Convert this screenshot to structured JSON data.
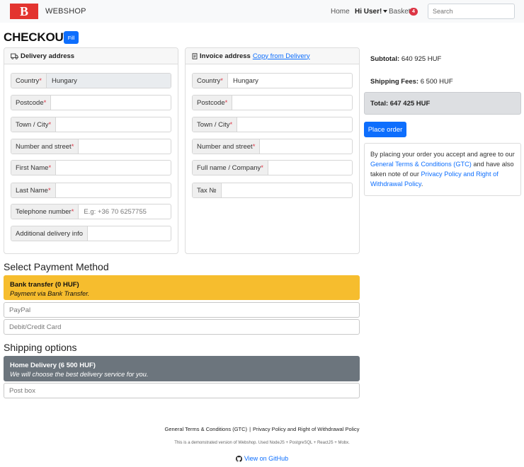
{
  "nav": {
    "logo_letter": "B",
    "brand": "WEBSHOP",
    "home": "Home",
    "user": "Hi User!",
    "basket": "Basket",
    "basket_count": "4",
    "search_placeholder": "Search"
  },
  "page": {
    "title": "CHECKOUT",
    "fill_button": "Fill"
  },
  "delivery": {
    "header": "Delivery address",
    "fields": {
      "country": {
        "label": "Country",
        "value": "Hungary"
      },
      "postcode": {
        "label": "Postcode",
        "value": ""
      },
      "town": {
        "label": "Town / City",
        "value": ""
      },
      "street": {
        "label": "Number and street",
        "value": ""
      },
      "first_name": {
        "label": "First Name",
        "value": ""
      },
      "last_name": {
        "label": "Last Name",
        "value": ""
      },
      "phone": {
        "label": "Telephone number",
        "placeholder": "E.g: +36 70 6257755"
      },
      "additional": {
        "label": "Additional delivery info",
        "value": ""
      }
    },
    "required_mark": "*"
  },
  "invoice": {
    "header": "Invoice address",
    "copy_link": "Copy from Delivery",
    "fields": {
      "country": {
        "label": "Country",
        "value": "Hungary"
      },
      "postcode": {
        "label": "Postcode",
        "value": ""
      },
      "town": {
        "label": "Town / City",
        "value": ""
      },
      "street": {
        "label": "Number and street",
        "value": ""
      },
      "full_name": {
        "label": "Full name / Company",
        "value": ""
      },
      "tax": {
        "label": "Tax №",
        "value": ""
      }
    }
  },
  "summary": {
    "subtotal_label": "Subtotal:",
    "subtotal_value": "640 925 HUF",
    "shipping_label": "Shipping Fees:",
    "shipping_value": "6 500 HUF",
    "total": "Total: 647 425 HUF",
    "place_order": "Place order",
    "terms_1": "By placing your order you accept and agree to our ",
    "terms_link_1": "General Terms & Conditions (GTC)",
    "terms_2": " and have also taken note of our ",
    "terms_link_2": "Privacy Policy and Right of Withdrawal Policy",
    "terms_3": "."
  },
  "payment": {
    "title": "Select Payment Method",
    "selected": {
      "title": "Bank transfer (0 HUF)",
      "subtitle": "Payment via Bank Transfer."
    },
    "options": [
      "PayPal",
      "Debit/Credit Card"
    ]
  },
  "shipping": {
    "title": "Shipping options",
    "selected": {
      "title": "Home Delivery (6 500 HUF)",
      "subtitle": "We will choose the best delivery service for you."
    },
    "options": [
      "Post box"
    ]
  },
  "footer": {
    "gtc": "General Terms & Conditions (GTC)",
    "separator": "|",
    "privacy": "Privacy Policy and Right of Withdrawal Policy",
    "note": "This is a demonstrated version of Webshop. Used NodeJS + PostgreSQL + ReactJS + Mobx.",
    "github": "View on GitHub"
  },
  "colors": {
    "primary": "#0d6efd",
    "bank_selected": "#f6bd2e",
    "home_selected": "#6c757d",
    "logo": "#e3342f",
    "danger": "#dc3545"
  }
}
